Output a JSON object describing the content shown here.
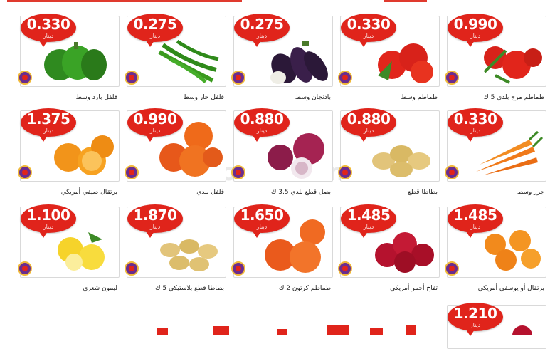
{
  "currency": "دينار",
  "watermark": "3orod.com",
  "products": [
    {
      "price": "0.330",
      "label": "فلفل بارد وسط"
    },
    {
      "price": "0.275",
      "label": "فلفل حار وسط"
    },
    {
      "price": "0.275",
      "label": "باذنجان وسط"
    },
    {
      "price": "0.330",
      "label": "طماطم وسط"
    },
    {
      "price": "0.990",
      "label": "طماطم مرج بلدي 5 ك"
    },
    {
      "price": "1.375",
      "label": "برتقال صيفي أمريكي"
    },
    {
      "price": "0.990",
      "label": "فلفل بلدي"
    },
    {
      "price": "0.880",
      "label": "بصل قطع بلدي 3.5 ك"
    },
    {
      "price": "0.880",
      "label": "بطاطا قطع"
    },
    {
      "price": "0.330",
      "label": "جزر وسط"
    },
    {
      "price": "1.100",
      "label": "ليمون شعري"
    },
    {
      "price": "1.870",
      "label": "بطاطا قطع بلاستيكي 5 ك"
    },
    {
      "price": "1.650",
      "label": "طماطم كرتون 2 ك"
    },
    {
      "price": "1.485",
      "label": "تفاح أحمر أمريكي"
    },
    {
      "price": "1.485",
      "label": "برتقال أو يوسفي أمريكي"
    },
    {
      "price": "1.210",
      "label": ""
    }
  ],
  "colors": {
    "badge": "#e0241b",
    "seal": "#6a2d8e",
    "accent": "#e03a2e"
  }
}
